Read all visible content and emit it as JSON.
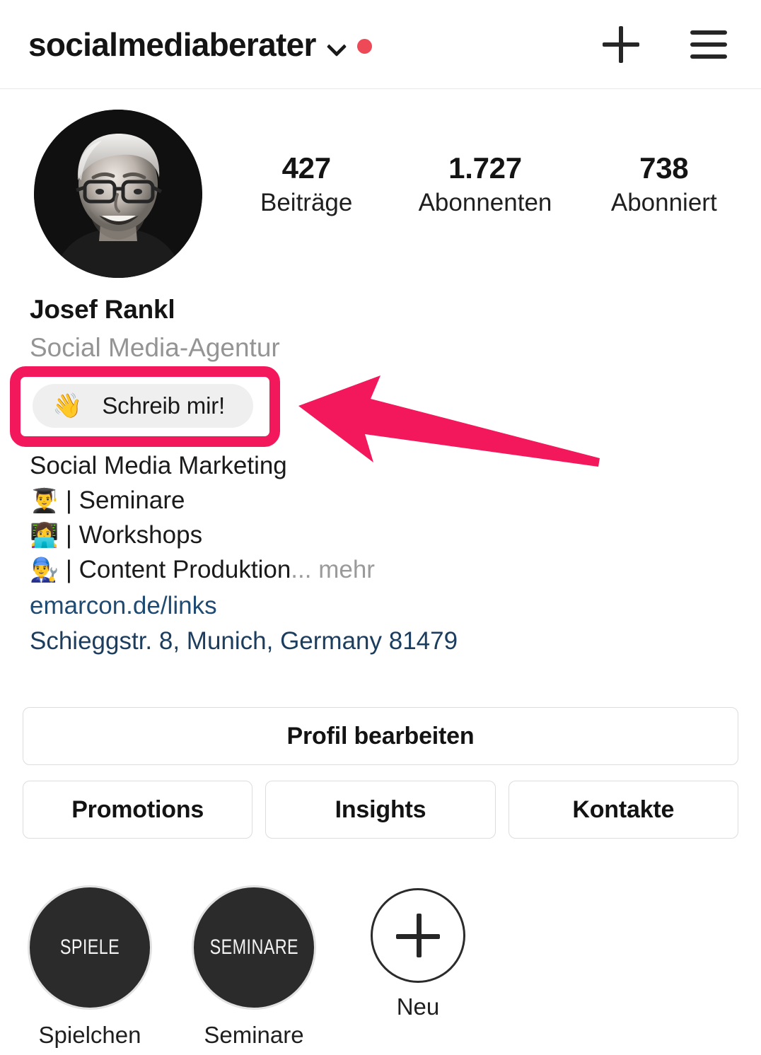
{
  "header": {
    "username": "socialmediaberater",
    "chevron_icon": "chevron-down-icon",
    "status_dot_color": "#ED4956",
    "add_icon": "plus-icon",
    "menu_icon": "hamburger-menu-icon"
  },
  "profile": {
    "avatar_alt": "profile-photo",
    "full_name": "Josef Rankl",
    "category": "Social Media-Agentur",
    "stats": [
      {
        "value": "427",
        "label": "Beiträge"
      },
      {
        "value": "1.727",
        "label": "Abonnenten"
      },
      {
        "value": "738",
        "label": "Abonniert"
      }
    ],
    "cta": {
      "emoji": "👋",
      "label": "Schreib mir!"
    },
    "bio": {
      "line1": "Social Media Marketing",
      "lines": [
        {
          "emoji": "👨‍🎓",
          "separator": "|",
          "text": "Seminare"
        },
        {
          "emoji": "👩‍💻",
          "separator": "|",
          "text": "Workshops"
        },
        {
          "emoji": "👨‍🔧",
          "separator": "|",
          "text": "Content Produktion"
        }
      ],
      "ellipsis": "...",
      "more_label": "mehr",
      "link": "emarcon.de/links",
      "address": "Schieggstr. 8, Munich, Germany 81479"
    }
  },
  "actions": {
    "edit_profile": "Profil bearbeiten",
    "promotions": "Promotions",
    "insights": "Insights",
    "contacts": "Kontakte"
  },
  "highlights": [
    {
      "cover_text": "SPIELE",
      "label": "Spielchen"
    },
    {
      "cover_text": "SEMINARE",
      "label": "Seminare"
    }
  ],
  "new_highlight": {
    "label": "Neu",
    "icon": "plus-icon"
  },
  "annotation": {
    "color": "#F3175B",
    "shape_box": "highlight-rectangle",
    "shape_arrow": "pointer-arrow-left"
  }
}
